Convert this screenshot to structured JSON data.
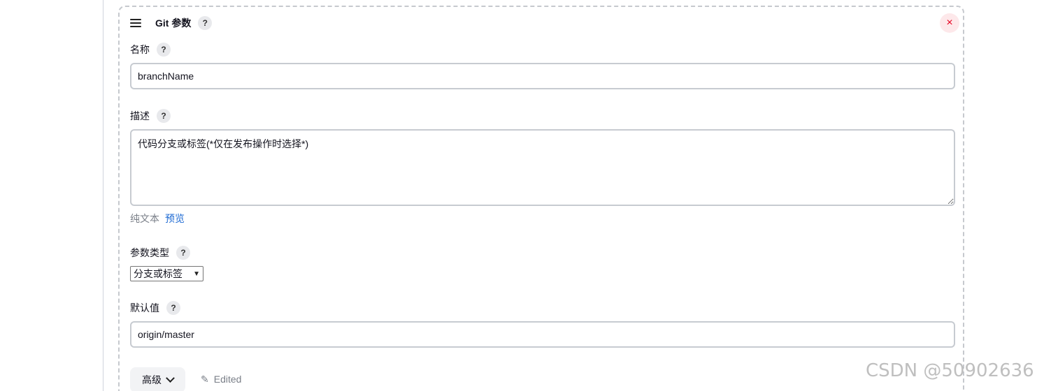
{
  "card": {
    "title": "Git 参数",
    "close_glyph": "×",
    "help_glyph": "?"
  },
  "fields": {
    "name": {
      "label": "名称",
      "value": "branchName"
    },
    "description": {
      "label": "描述",
      "value": "代码分支或标签(*仅在发布操作时选择*)",
      "format_plain": "纯文本",
      "format_preview": "预览"
    },
    "param_type": {
      "label": "参数类型",
      "selected": "分支或标签"
    },
    "default_value": {
      "label": "默认值",
      "value": "origin/master"
    }
  },
  "footer": {
    "advanced_label": "高级",
    "edited_label": "Edited"
  },
  "watermark": "CSDN @50902636",
  "icons": {
    "drag": "drag-handle-icon",
    "help": "question-mark-icon",
    "close": "close-icon",
    "chevron": "chevron-down-icon",
    "pencil": "pencil-icon"
  },
  "colors": {
    "link": "#1e6ad3",
    "close": "#e6001f",
    "close_bg": "#fde8ea"
  }
}
